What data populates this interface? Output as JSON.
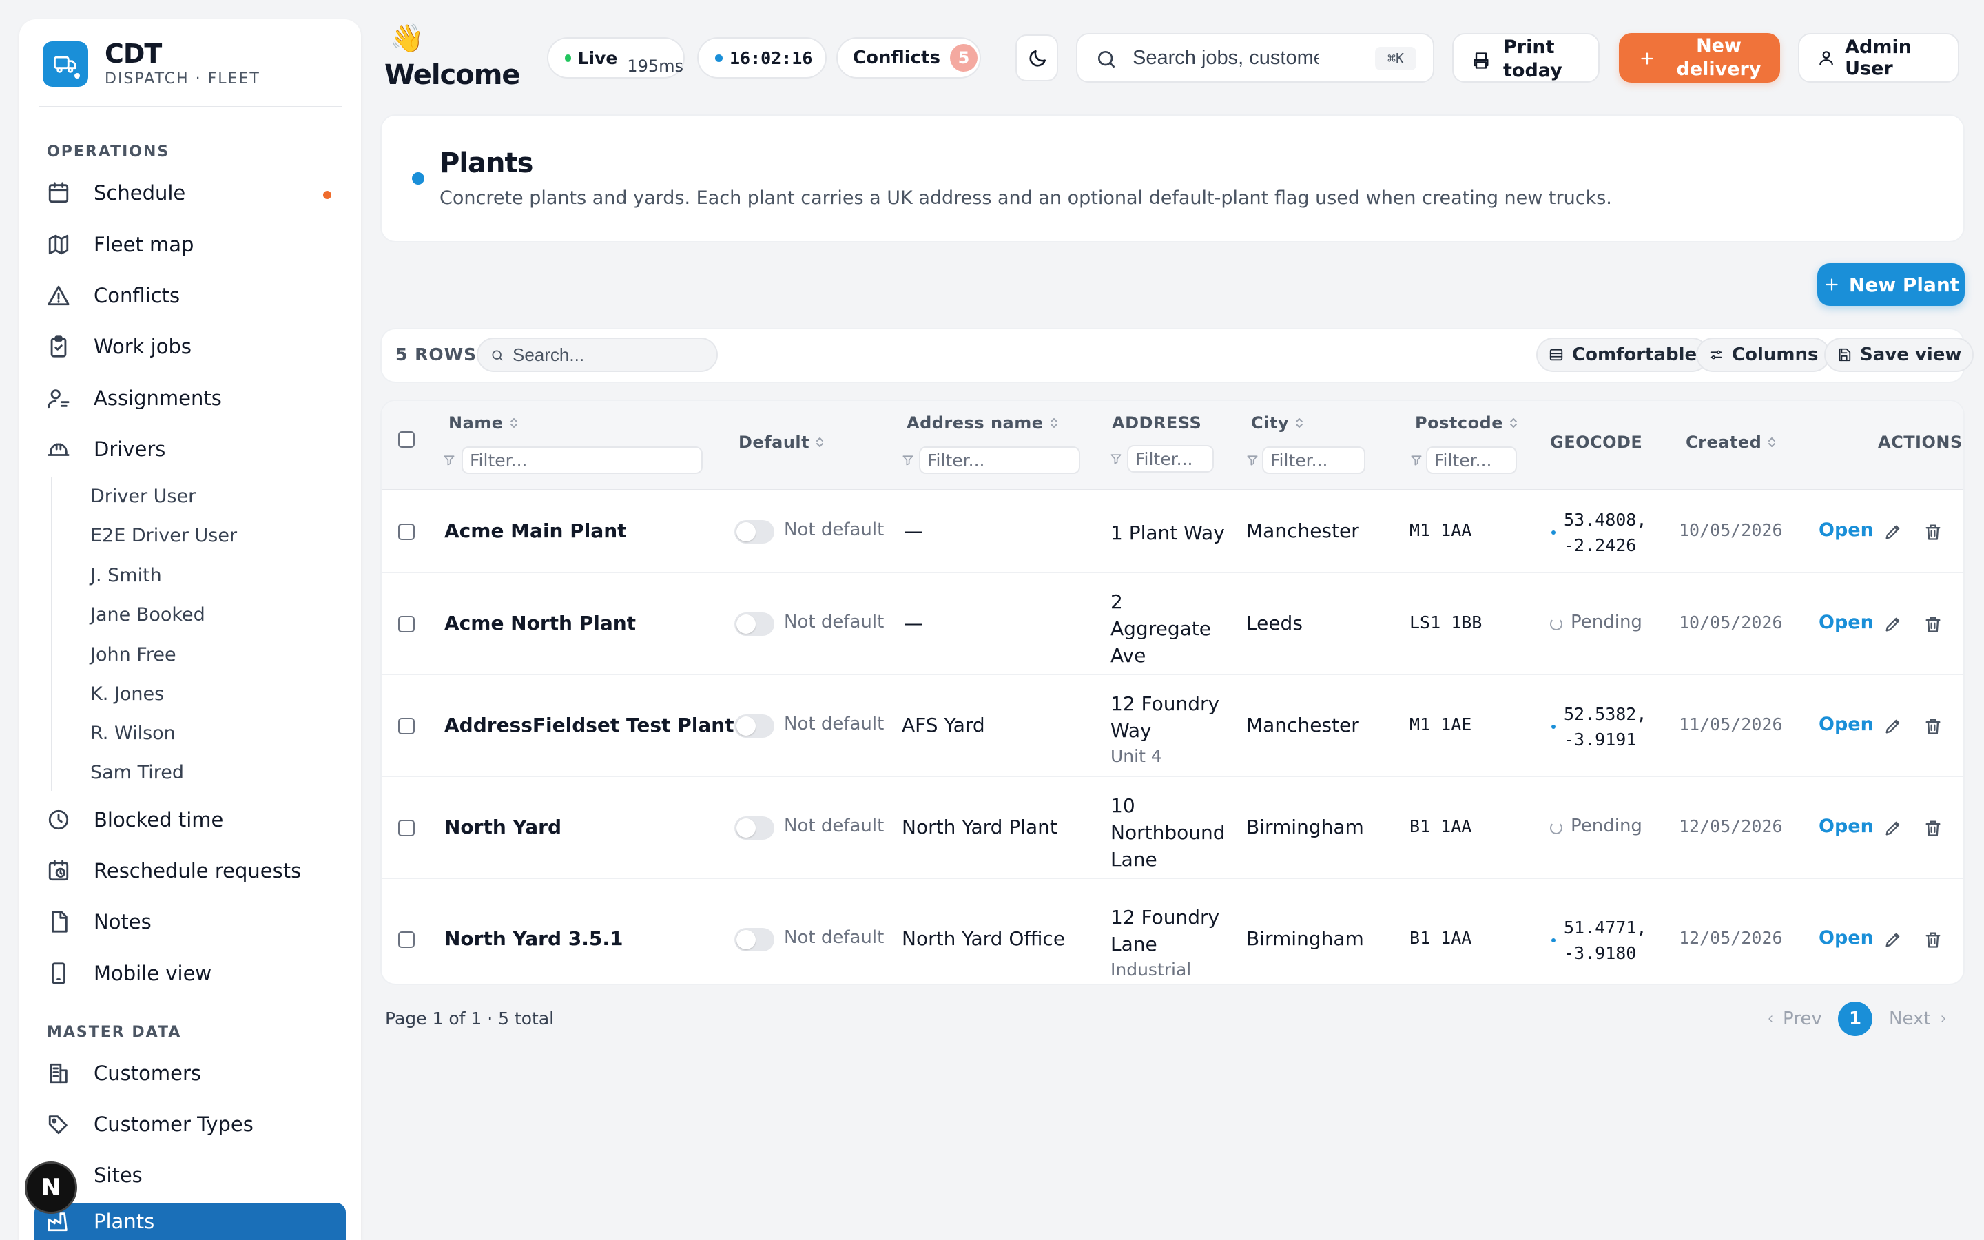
{
  "brand": {
    "name": "CDT",
    "subtitle": "DISPATCH · FLEET"
  },
  "sidebar": {
    "operations_label": "OPERATIONS",
    "master_label": "MASTER DATA",
    "items": {
      "schedule": "Schedule",
      "fleet_map": "Fleet map",
      "conflicts": "Conflicts",
      "work_jobs": "Work jobs",
      "assignments": "Assignments",
      "drivers": "Drivers",
      "blocked_time": "Blocked time",
      "reschedule": "Reschedule requests",
      "notes": "Notes",
      "mobile": "Mobile view",
      "customers": "Customers",
      "customer_types": "Customer Types",
      "sites": "Sites",
      "plants": "Plants"
    },
    "drivers": [
      "Driver User",
      "E2E Driver User",
      "J. Smith",
      "Jane Booked",
      "John Free",
      "K. Jones",
      "R. Wilson",
      "Sam Tired"
    ],
    "avatar_letter": "N"
  },
  "header": {
    "wave": "👋",
    "welcome": "Welcome",
    "live_label": "Live",
    "latency": "195ms",
    "clock": "16:02:16",
    "conflicts_label": "Conflicts",
    "conflicts_count": "5",
    "search_placeholder": "Search jobs, customers...",
    "search_kbd": "⌘K",
    "print_label": "Print today",
    "new_delivery_label": "New delivery",
    "user_label": "Admin User"
  },
  "page": {
    "title": "Plants",
    "description": "Concrete plants and yards. Each plant carries a UK address and an optional default-plant flag used when creating new trucks.",
    "new_button": "New Plant"
  },
  "toolbar": {
    "rows_label": "5 ROWS",
    "search_placeholder": "Search...",
    "density": "Comfortable",
    "columns": "Columns",
    "save_view": "Save view"
  },
  "table": {
    "columns": {
      "name": "Name",
      "default": "Default",
      "address_name": "Address name",
      "address": "ADDRESS",
      "city": "City",
      "postcode": "Postcode",
      "geocode": "GEOCODE",
      "created": "Created",
      "actions": "ACTIONS"
    },
    "filter_placeholder": "Filter...",
    "open_label": "Open",
    "rows": [
      {
        "name": "Acme Main Plant",
        "default": "Not default",
        "address_name": "—",
        "address": "1 Plant Way",
        "address_extra": "",
        "city": "Manchester",
        "postcode": "M1 1AA",
        "geo1": "53.4808,",
        "geo2": "-2.2426",
        "pending": "",
        "created": "10/05/2026"
      },
      {
        "name": "Acme North Plant",
        "default": "Not default",
        "address_name": "—",
        "address": "2 Aggregate Ave",
        "address_extra": "",
        "city": "Leeds",
        "postcode": "LS1 1BB",
        "geo1": "",
        "geo2": "",
        "pending": "Pending",
        "created": "10/05/2026"
      },
      {
        "name": "AddressFieldset Test Plant",
        "default": "Not default",
        "address_name": "AFS Yard",
        "address": "12 Foundry Way",
        "address_extra": "Unit 4",
        "city": "Manchester",
        "postcode": "M1 1AE",
        "geo1": "52.5382,",
        "geo2": "-3.9191",
        "pending": "",
        "created": "11/05/2026"
      },
      {
        "name": "North Yard",
        "default": "Not default",
        "address_name": "North Yard Plant",
        "address": "10 Northbound Lane",
        "address_extra": "",
        "city": "Birmingham",
        "postcode": "B1 1AA",
        "geo1": "",
        "geo2": "",
        "pending": "Pending",
        "created": "12/05/2026"
      },
      {
        "name": "North Yard 3.5.1",
        "default": "Not default",
        "address_name": "North Yard Office",
        "address": "12 Foundry Lane",
        "address_extra": "Industrial Estate",
        "city": "Birmingham",
        "postcode": "B1 1AA",
        "geo1": "51.4771,",
        "geo2": "-3.9180",
        "pending": "",
        "created": "12/05/2026"
      }
    ]
  },
  "footer": {
    "page_info": "Page 1 of 1 · 5 total",
    "prev": "Prev",
    "current": "1",
    "next": "Next"
  },
  "colors": {
    "accent": "#1a8fd8",
    "orange": "#f0733a",
    "active_nav": "#1a6fb8",
    "live": "#22c55e"
  }
}
